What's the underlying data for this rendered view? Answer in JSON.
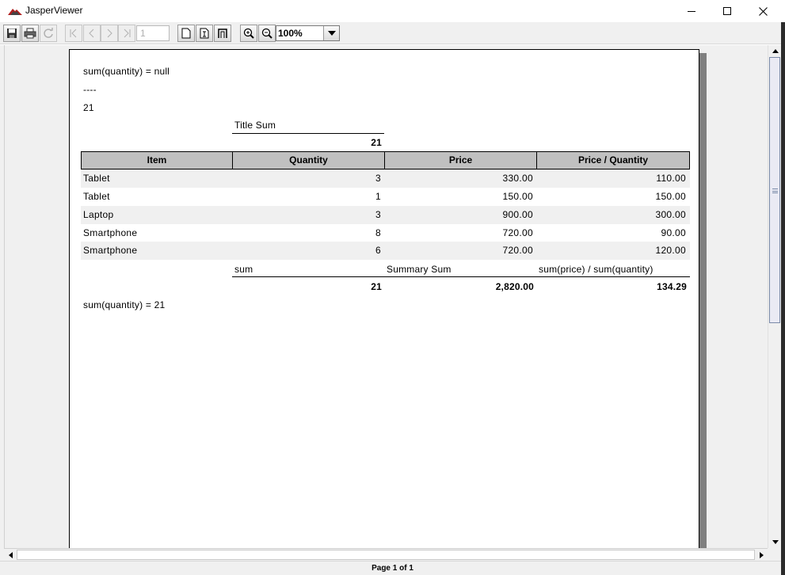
{
  "window": {
    "title": "JasperViewer",
    "accent_color": "#b01e1e"
  },
  "toolbar": {
    "page_number": "1",
    "zoom_value": "100%",
    "icons": [
      "save-icon",
      "print-icon",
      "reload-icon",
      "first-page-icon",
      "previous-page-icon",
      "next-page-icon",
      "last-page-icon",
      "actual-size-icon",
      "fit-page-icon",
      "fit-width-icon",
      "zoom-in-icon",
      "zoom-out-icon"
    ]
  },
  "report": {
    "line1": "sum(quantity) = null",
    "line2": "----",
    "line3": "21",
    "title_sum_label": "Title Sum",
    "title_sum_value": "21",
    "headers": [
      "Item",
      "Quantity",
      "Price",
      "Price / Quantity"
    ],
    "rows": [
      {
        "item": "Tablet",
        "quantity": "3",
        "price": "330.00",
        "ppq": "110.00"
      },
      {
        "item": "Tablet",
        "quantity": "1",
        "price": "150.00",
        "ppq": "150.00"
      },
      {
        "item": "Laptop",
        "quantity": "3",
        "price": "900.00",
        "ppq": "300.00"
      },
      {
        "item": "Smartphone",
        "quantity": "8",
        "price": "720.00",
        "ppq": "90.00"
      },
      {
        "item": "Smartphone",
        "quantity": "6",
        "price": "720.00",
        "ppq": "120.00"
      }
    ],
    "footer_labels": {
      "sum": "sum",
      "summary_sum": "Summary Sum",
      "ratio": "sum(price) / sum(quantity)"
    },
    "footer_values": {
      "quantity": "21",
      "price": "2,820.00",
      "ratio": "134.29"
    },
    "bottom_line": "sum(quantity) = 21"
  },
  "status": {
    "page_info": "Page 1 of 1"
  }
}
